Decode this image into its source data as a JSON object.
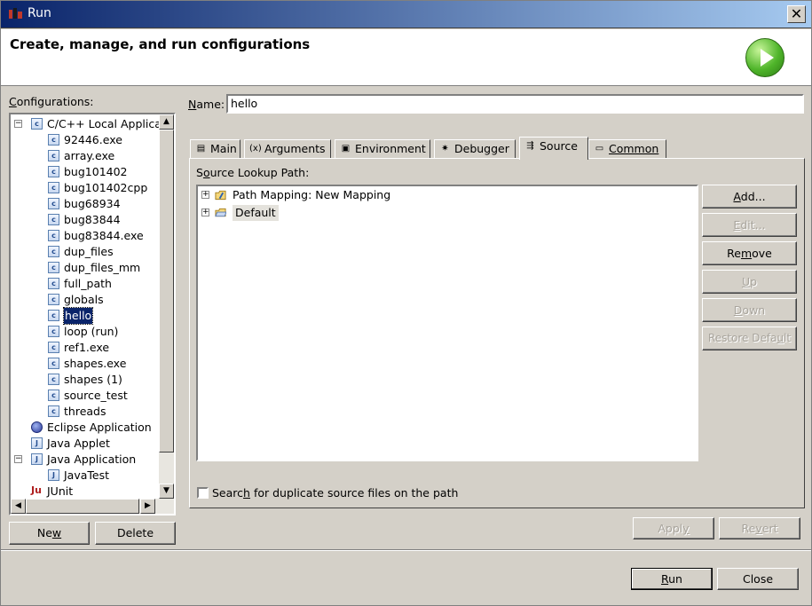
{
  "window": {
    "title": "Run",
    "close_glyph": "✕"
  },
  "header": {
    "title": "Create, manage, and run configurations",
    "icon": "run-icon"
  },
  "configurations": {
    "label_prefix": "",
    "label_u": "C",
    "label_rest": "onfigurations:",
    "tree": {
      "group_cpp": "C/C++ Local Applicatic",
      "cpp_items": [
        "92446.exe",
        "array.exe",
        "bug101402",
        "bug101402cpp",
        "bug68934",
        "bug83844",
        "bug83844.exe",
        "dup_files",
        "dup_files_mm",
        "full_path",
        "globals",
        "hello",
        "loop (run)",
        "ref1.exe",
        "shapes.exe",
        "shapes (1)",
        "source_test",
        "threads"
      ],
      "eclipse_app": "Eclipse Application",
      "java_applet": "Java Applet",
      "java_application": "Java Application",
      "java_test": "JavaTest",
      "junit": "JUnit",
      "selected": "hello"
    },
    "new_u": "w",
    "new_pre": "Ne",
    "new_post": "",
    "delete_label": "Delete"
  },
  "name_field": {
    "label_u": "N",
    "label_rest": "ame:",
    "value": "hello"
  },
  "tabs": [
    {
      "label": "Main",
      "icon": "main-icon"
    },
    {
      "label": "Arguments",
      "icon": "arguments-icon"
    },
    {
      "label": "Environment",
      "icon": "environment-icon"
    },
    {
      "label": "Debugger",
      "icon": "debugger-icon"
    },
    {
      "label": "Source",
      "icon": "source-icon",
      "selected": true
    },
    {
      "label": "Common",
      "icon": "common-icon"
    }
  ],
  "source": {
    "lookup_label_pre": "S",
    "lookup_label_u": "o",
    "lookup_label_post": "urce Lookup Path:",
    "entries": [
      "Path Mapping: New Mapping",
      "Default"
    ],
    "buttons": {
      "add": {
        "pre": "",
        "u": "A",
        "post": "dd..."
      },
      "edit": {
        "pre": "",
        "u": "E",
        "post": "dit..."
      },
      "remove": {
        "pre": "Re",
        "u": "m",
        "post": "ove"
      },
      "up": {
        "pre": "",
        "u": "U",
        "post": "p"
      },
      "down": {
        "pre": "",
        "u": "D",
        "post": "own"
      },
      "restore": {
        "pre": "Restore Defa",
        "u": "u",
        "post": "lt"
      }
    },
    "search_pre": "Searc",
    "search_u": "h",
    "search_post": " for duplicate source files on the path",
    "search_checked": false
  },
  "footer": {
    "apply": {
      "pre": "Appl",
      "u": "y",
      "post": ""
    },
    "revert": {
      "pre": "Re",
      "u": "v",
      "post": "ert"
    },
    "run": {
      "pre": "",
      "u": "R",
      "post": "un"
    },
    "close": "Close"
  }
}
